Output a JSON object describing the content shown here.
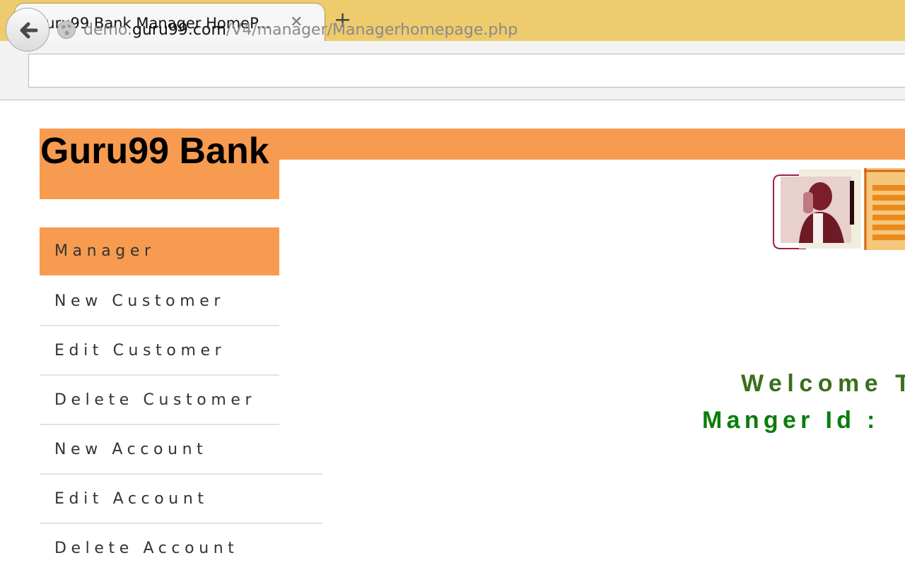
{
  "browser": {
    "tab_title": "Guru99 Bank Manager HomeP...",
    "tab_close_symbol": "✕",
    "new_tab_symbol": "+",
    "url_prefix": "demo.",
    "url_domain": "guru99.com",
    "url_path": "/V4/manager/Managerhomepage.php",
    "icons": [
      "back-arrow-icon",
      "globe-icon",
      "close-icon",
      "plus-icon"
    ]
  },
  "header": {
    "brand": "Guru99 Bank",
    "brand_color": "#f79b50"
  },
  "sidebar": {
    "items": [
      {
        "label": "Manager",
        "active": true
      },
      {
        "label": "New Customer"
      },
      {
        "label": "Edit Customer"
      },
      {
        "label": "Delete Customer"
      },
      {
        "label": "New Account"
      },
      {
        "label": "Edit Account"
      },
      {
        "label": "Delete Account"
      }
    ]
  },
  "main": {
    "welcome_text": "Welcome T",
    "manager_id_text": "Manger Id :",
    "welcome_color": "#3c6e1c",
    "manager_id_color": "#0b7d0b"
  }
}
